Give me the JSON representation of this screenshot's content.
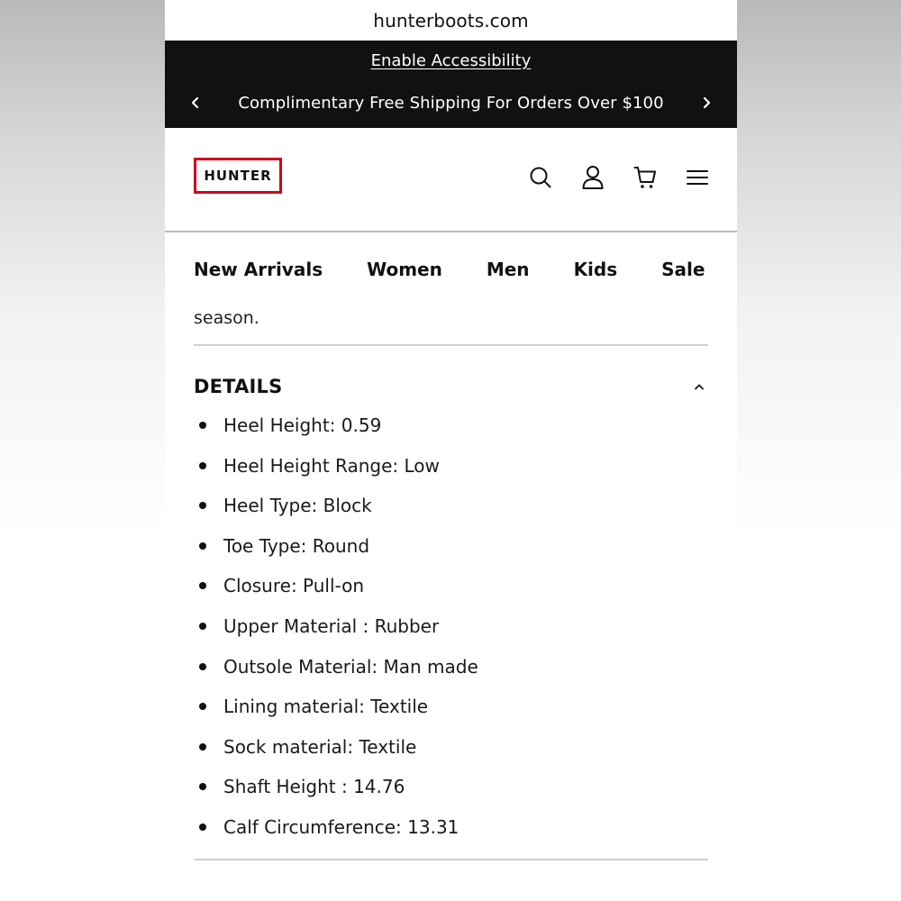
{
  "browser": {
    "url": "hunterboots.com"
  },
  "promo": {
    "accessibility_link": "Enable Accessibility",
    "shipping_message": "Complimentary Free Shipping For Orders Over $100",
    "prev_icon": "chevron-left-icon",
    "next_icon": "chevron-right-icon"
  },
  "header": {
    "logo_text": "HUNTER",
    "logo_color": "#d0021b",
    "icons": [
      "search-icon",
      "account-icon",
      "cart-icon",
      "menu-icon"
    ]
  },
  "nav": {
    "items": [
      "New Arrivals",
      "Women",
      "Men",
      "Kids",
      "Sale"
    ]
  },
  "description": {
    "trailing_text": "season."
  },
  "details": {
    "title": "DETAILS",
    "toggle_icon": "chevron-up-icon",
    "items": [
      "Heel Height: 0.59",
      "Heel Height Range: Low",
      "Heel Type: Block",
      "Toe Type: Round",
      "Closure: Pull-on",
      "Upper Material : Rubber",
      "Outsole Material: Man made",
      "Lining material: Textile",
      "Sock material: Textile",
      "Shaft Height : 14.76",
      "Calf Circumference: 13.31"
    ]
  }
}
